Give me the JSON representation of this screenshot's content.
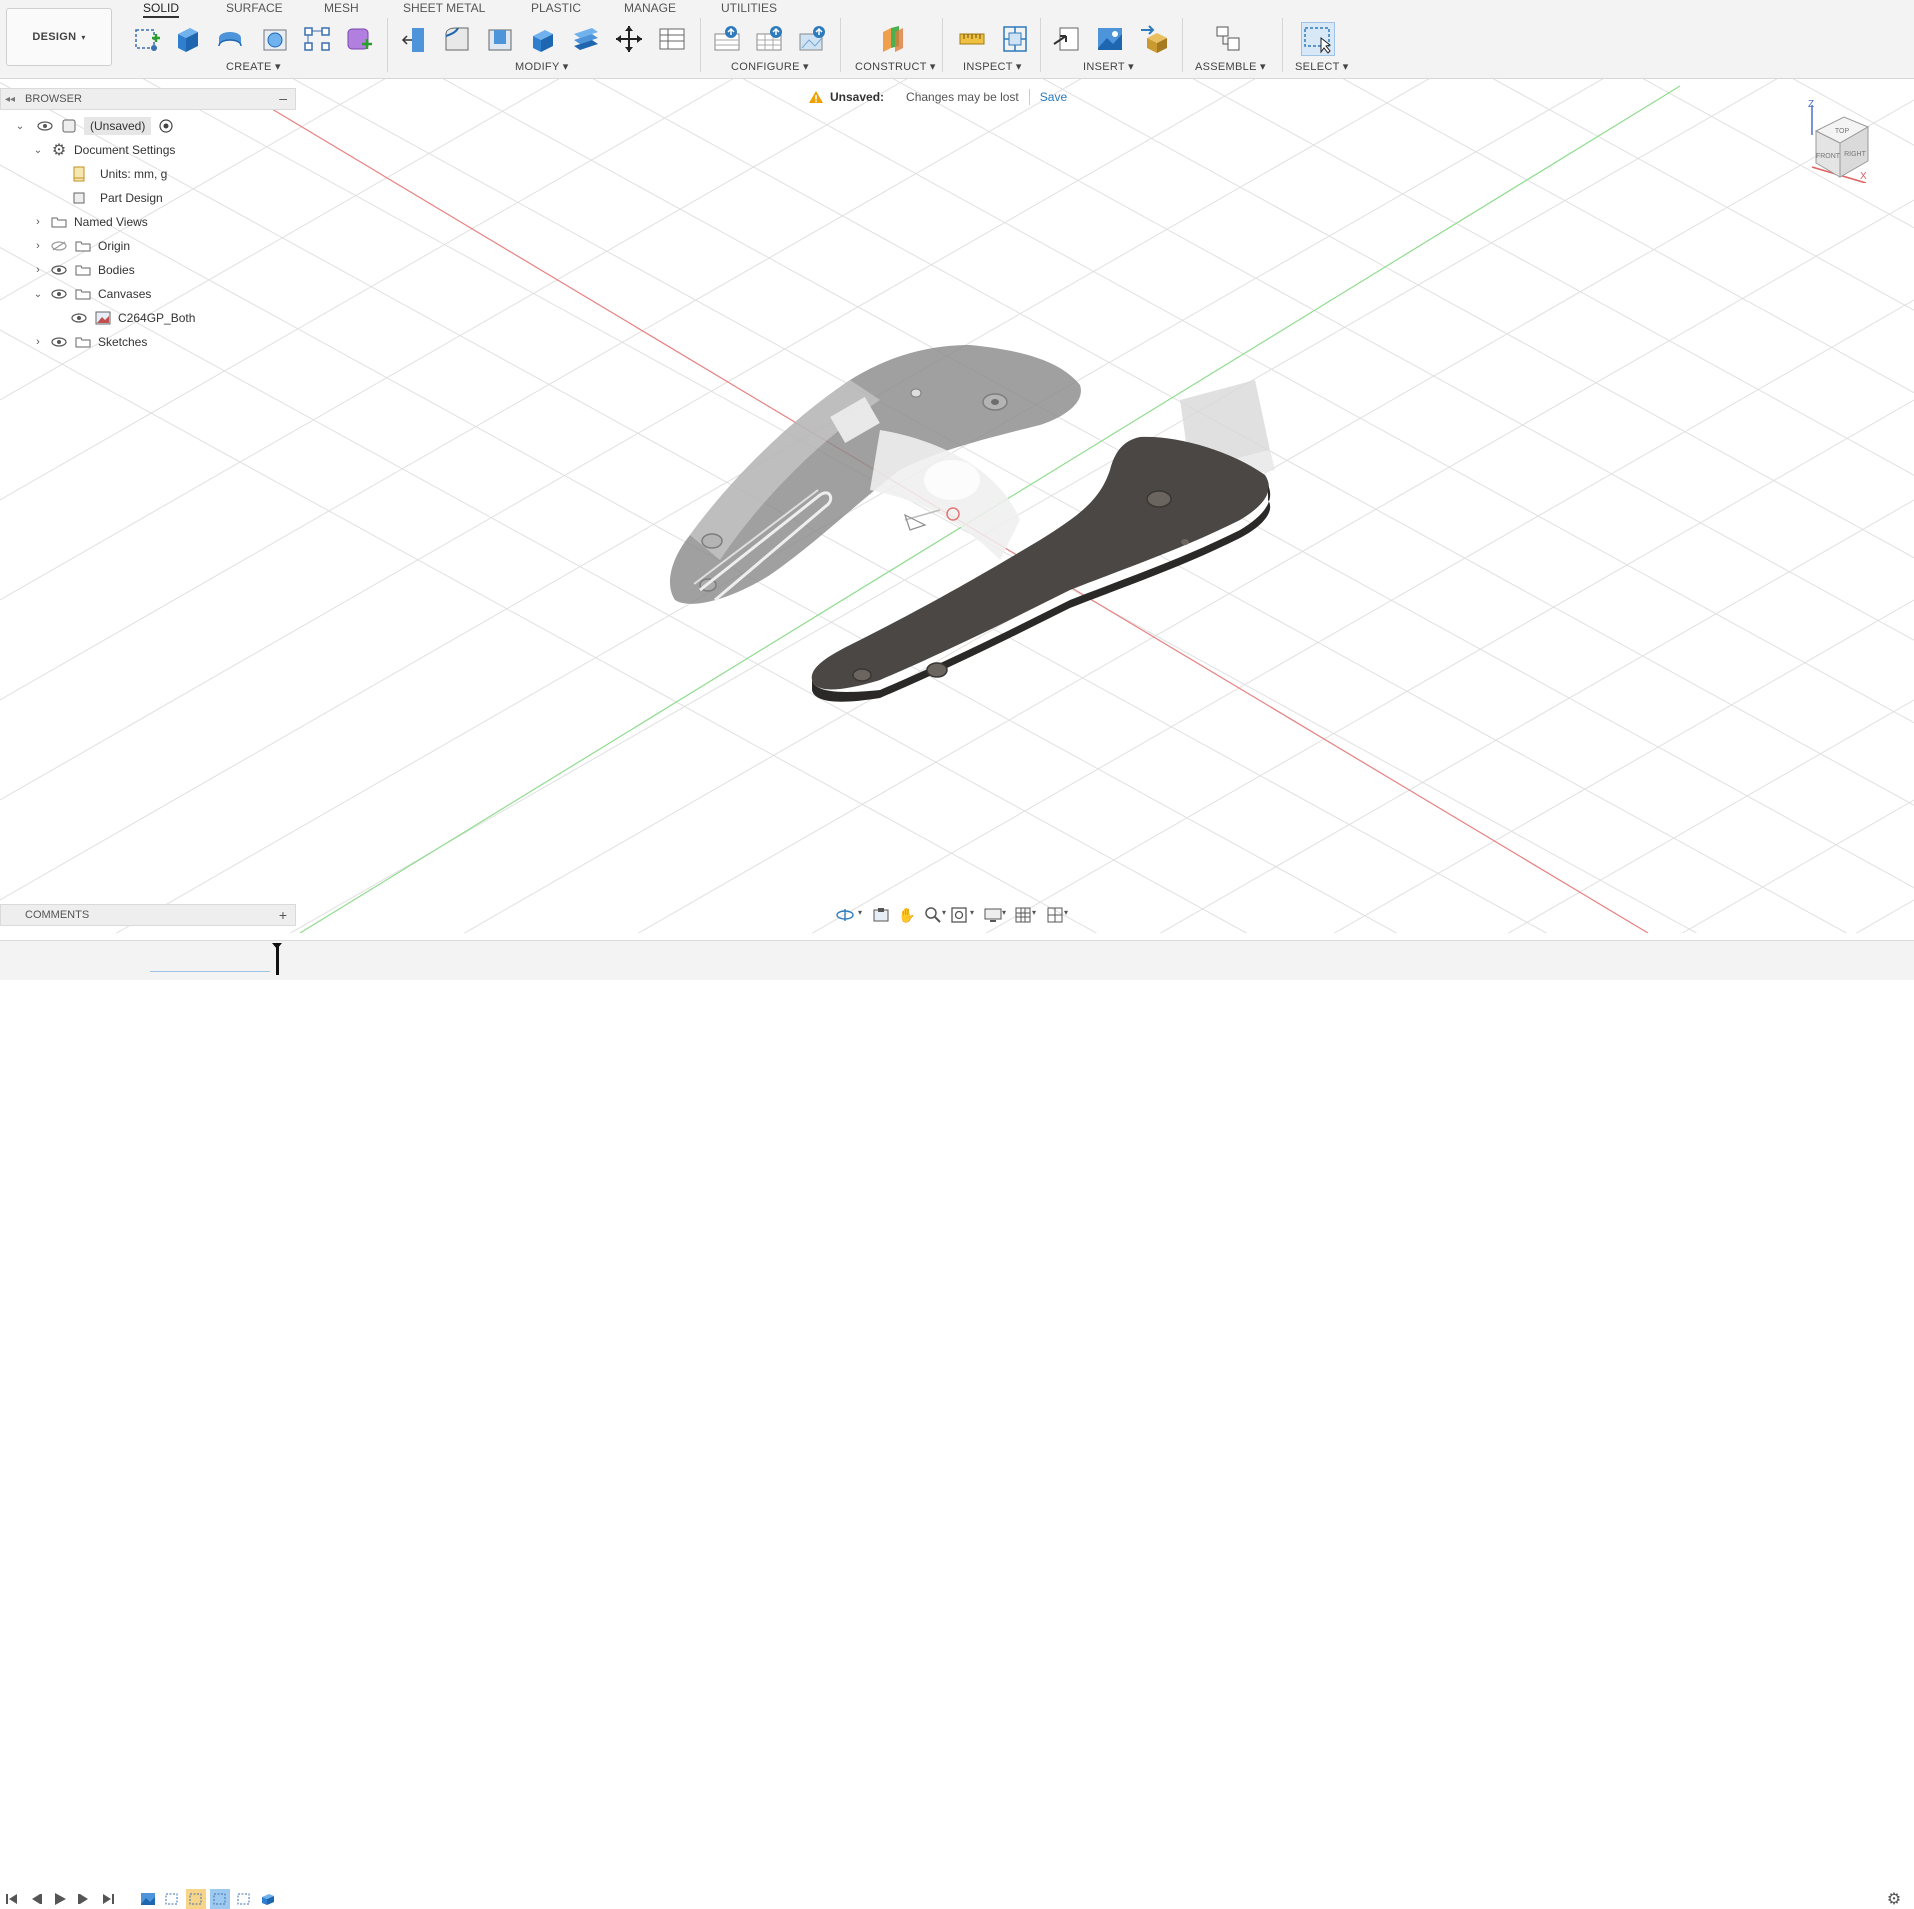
{
  "workspace": {
    "label": "DESIGN"
  },
  "tabs": [
    "SOLID",
    "SURFACE",
    "MESH",
    "SHEET METAL",
    "PLASTIC",
    "MANAGE",
    "UTILITIES"
  ],
  "groups": {
    "create": "CREATE",
    "modify": "MODIFY",
    "configure": "CONFIGURE",
    "construct": "CONSTRUCT",
    "inspect": "INSPECT",
    "insert": "INSERT",
    "assemble": "ASSEMBLE",
    "select": "SELECT"
  },
  "browser": {
    "title": "BROWSER",
    "root": "(Unsaved)",
    "document_settings": "Document Settings",
    "units": "Units: mm, g",
    "part_design": "Part Design",
    "named_views": "Named Views",
    "origin": "Origin",
    "bodies": "Bodies",
    "canvases": "Canvases",
    "canvas_item": "C264GP_Both",
    "sketches": "Sketches"
  },
  "banner": {
    "status": "Unsaved:",
    "message": "Changes may be lost",
    "action": "Save"
  },
  "comments": {
    "title": "COMMENTS"
  },
  "viewcube": {
    "top": "TOP",
    "front": "FRONT",
    "right": "RIGHT",
    "x": "X",
    "z": "Z"
  },
  "colors": {
    "accent": "#2d7bbd",
    "warning": "#f0a000",
    "grid": "#d9d9d9",
    "axis_red": "#e06060",
    "axis_green": "#5ccd5c"
  }
}
